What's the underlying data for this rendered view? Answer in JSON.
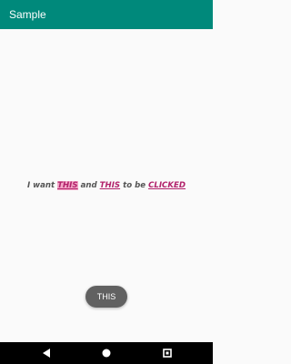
{
  "app_bar": {
    "title": "Sample",
    "color": "#00897b"
  },
  "content": {
    "sentence": {
      "part1": "I want ",
      "link1": "THIS",
      "part2": " and ",
      "link2": "THIS",
      "part3": " to be ",
      "link3": "CLICKED"
    },
    "link_color": "#b2226b",
    "highlight_color": "#f3a8c8"
  },
  "toast": {
    "text": "THIS"
  },
  "nav_bar": {
    "back_icon": "triangle-back-icon",
    "home_icon": "circle-home-icon",
    "recent_icon": "square-recent-icon"
  }
}
